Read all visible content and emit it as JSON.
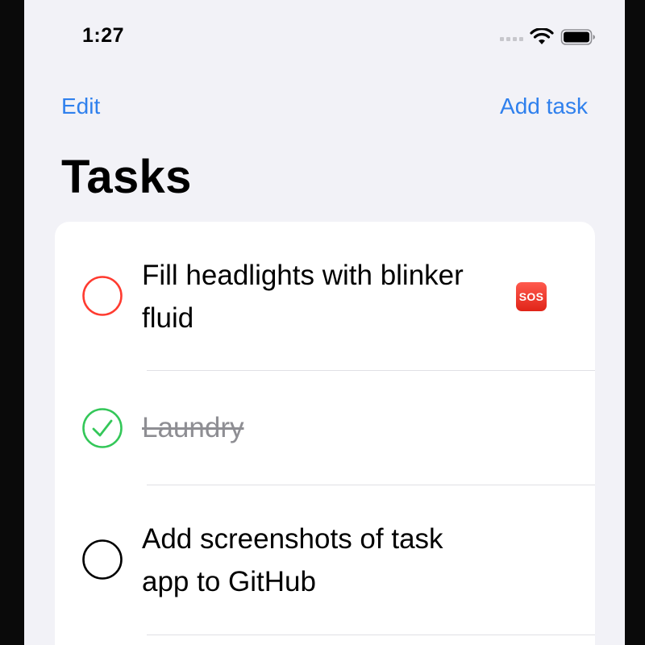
{
  "status_bar": {
    "time": "1:27",
    "icons": [
      "cellular-signal-icon",
      "wifi-icon",
      "battery-icon"
    ]
  },
  "nav": {
    "edit_label": "Edit",
    "add_label": "Add task",
    "title": "Tasks"
  },
  "colors": {
    "accent": "#2f80ed",
    "priority_high": "#ff3b30",
    "completed": "#34c759",
    "default_check": "#000000",
    "background": "#f2f2f7"
  },
  "tasks": [
    {
      "title": "Fill headlights with blinker fluid",
      "completed": false,
      "check_color": "red",
      "badge": "SOS"
    },
    {
      "title": "Laundry",
      "completed": true,
      "check_color": "green"
    },
    {
      "title": "Add screenshots of task app to GitHub",
      "completed": false,
      "check_color": "black"
    }
  ]
}
